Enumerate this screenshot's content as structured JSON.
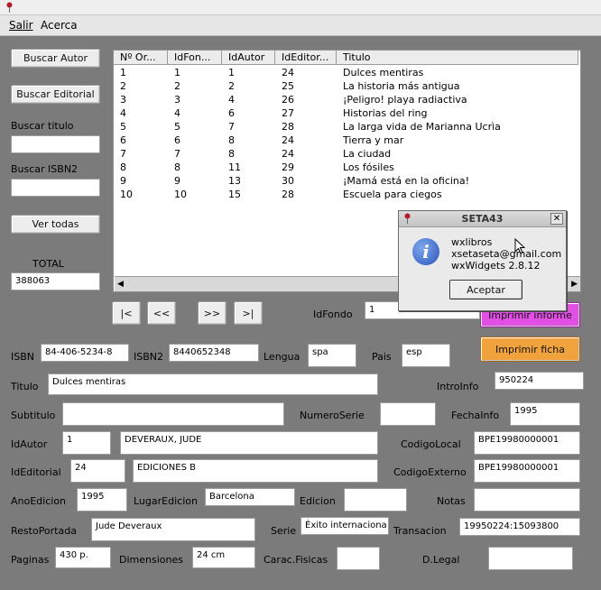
{
  "menu": [
    "Salir",
    "Acerca"
  ],
  "sidebar": {
    "buscar_autor": "Buscar Autor",
    "buscar_editorial": "Buscar Editorial",
    "buscar_titulo_label": "Buscar titulo",
    "buscar_titulo_value": "",
    "buscar_isbn_label": "Buscar ISBN2",
    "buscar_isbn_value": "",
    "ver_todas": "Ver todas",
    "total_label": "TOTAL",
    "total_value": "388063"
  },
  "list": {
    "columns": [
      "Nº Or...",
      "IdFon...",
      "IdAutor",
      "IdEditor...",
      "Titulo"
    ],
    "rows": [
      [
        "1",
        "1",
        "1",
        "24",
        "Dulces mentiras"
      ],
      [
        "2",
        "2",
        "2",
        "25",
        "La historia más antigua"
      ],
      [
        "3",
        "3",
        "4",
        "26",
        "¡Peligro! playa radiactiva"
      ],
      [
        "4",
        "4",
        "6",
        "27",
        "Historias del ring"
      ],
      [
        "5",
        "5",
        "7",
        "28",
        "La larga vida de Marianna Ucrìa"
      ],
      [
        "6",
        "6",
        "8",
        "24",
        "Tierra y mar"
      ],
      [
        "7",
        "7",
        "8",
        "24",
        "La ciudad"
      ],
      [
        "8",
        "8",
        "11",
        "29",
        "Los fósiles"
      ],
      [
        "9",
        "9",
        "13",
        "30",
        "¡Mamá está en la oficina!"
      ],
      [
        "10",
        "10",
        "15",
        "28",
        "Escuela para ciegos"
      ]
    ]
  },
  "nav": {
    "first": "|<",
    "prev": "<<",
    "next": ">>",
    "last": ">|"
  },
  "dialog": {
    "title": "SETA43",
    "lines": [
      "wxlibros",
      "xsetaseta@gmail.com",
      "wxWidgets 2.8.12"
    ],
    "ok": "Aceptar"
  },
  "buttons": {
    "imprimir_informe": "Imprimir informe",
    "imprimir_ficha": "Imprimir ficha"
  },
  "form": {
    "idfondo_label": "IdFondo",
    "idfondo": "1",
    "isbn_label": "ISBN",
    "isbn": "84-406-5234-8",
    "isbn2_label": "ISBN2",
    "isbn2": "8440652348",
    "lengua_label": "Lengua",
    "lengua": "spa",
    "pais_label": "Pais",
    "pais": "esp",
    "titulo_label": "Titulo",
    "titulo": "Dulces mentiras",
    "introinfo_label": "IntroInfo",
    "introinfo": "950224",
    "subtitulo_label": "Subtitulo",
    "subtitulo": "",
    "numeroserie_label": "NumeroSerie",
    "numeroserie": "",
    "fechainfo_label": "FechaInfo",
    "fechainfo": "1995",
    "idautor_label": "IdAutor",
    "idautor": "1",
    "autor_nombre": "DEVERAUX, JUDE",
    "codigolocal_label": "CodigoLocal",
    "codigolocal": "BPE19980000001",
    "ideditorial_label": "IdEditorial",
    "ideditorial": "24",
    "editorial_nombre": "EDICIONES B",
    "codigoexterno_label": "CodigoExterno",
    "codigoexterno": "BPE19980000001",
    "anoedicion_label": "AnoEdicion",
    "anoedicion": "1995",
    "lugaredicion_label": "LugarEdicion",
    "lugaredicion": "Barcelona",
    "edicion_label": "Edicion",
    "edicion": "",
    "notas_label": "Notas",
    "notas": "",
    "restoportada_label": "RestoPortada",
    "restoportada": "Jude Deveraux",
    "serie_label": "Serie",
    "serie": "Éxito internaciona",
    "transaccion_label": "Transacion",
    "transaccion": "19950224:15093800",
    "paginas_label": "Paginas",
    "paginas": "430 p.",
    "dimensiones_label": "Dimensiones",
    "dimensiones": "24 cm",
    "caracfisicas_label": "Carac.Fisicas",
    "caracfisicas": "",
    "dlegal_label": "D.Legal",
    "dlegal": ""
  }
}
